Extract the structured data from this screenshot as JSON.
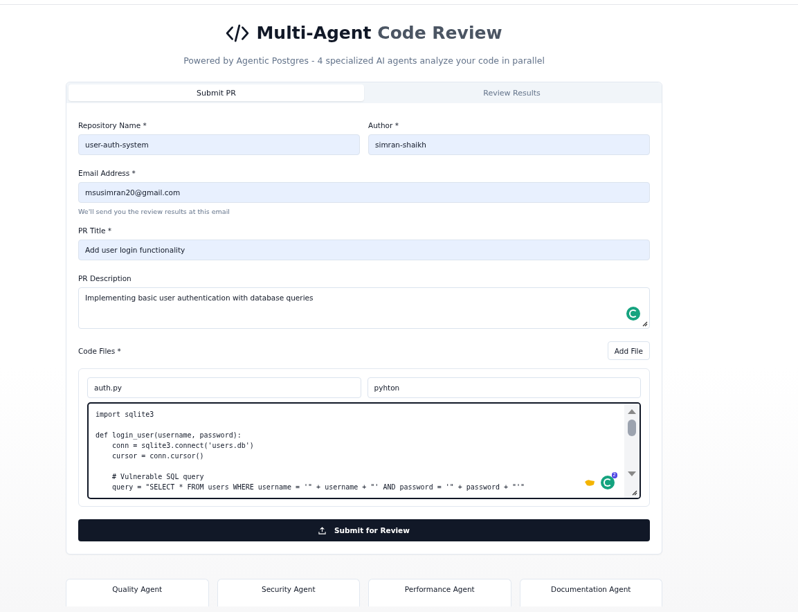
{
  "header": {
    "title_dark": "Multi-Agent",
    "title_grey": "Code Review",
    "subtitle": "Powered by Agentic Postgres - 4 specialized AI agents analyze your code in parallel"
  },
  "tabs": [
    {
      "label": "Submit PR",
      "selected": true
    },
    {
      "label": "Review Results",
      "selected": false
    }
  ],
  "form": {
    "repository": {
      "label": "Repository Name *",
      "value": "user-auth-system"
    },
    "author": {
      "label": "Author *",
      "value": "simran-shaikh"
    },
    "email": {
      "label": "Email Address *",
      "value": "msusimran20@gmail.com",
      "hint": "We'll send you the review results at this email"
    },
    "pr_title": {
      "label": "PR Title *",
      "value": "Add user login functionality"
    },
    "pr_description": {
      "label": "PR Description",
      "value": "Implementing basic user authentication with database queries"
    },
    "code_files": {
      "label": "Code Files *",
      "add_button": "Add File",
      "files": [
        {
          "filename": "auth.py",
          "language": "pyhton",
          "code_blocks": [
            [
              "import sqlite3"
            ],
            [
              "def login_user(username, password):",
              "    conn = sqlite3.connect('users.db')",
              "    cursor = conn.cursor()"
            ],
            [
              "    # Vulnerable SQL query",
              "    query = \"SELECT * FROM users WHERE username = '\" + username + \"' AND password = '\" + password + \"'\""
            ]
          ],
          "grammarly_count": "2"
        }
      ]
    },
    "submit_button": "Submit for Review"
  },
  "agents": [
    {
      "name": "Quality Agent"
    },
    {
      "name": "Security Agent"
    },
    {
      "name": "Performance Agent"
    },
    {
      "name": "Documentation Agent"
    }
  ]
}
